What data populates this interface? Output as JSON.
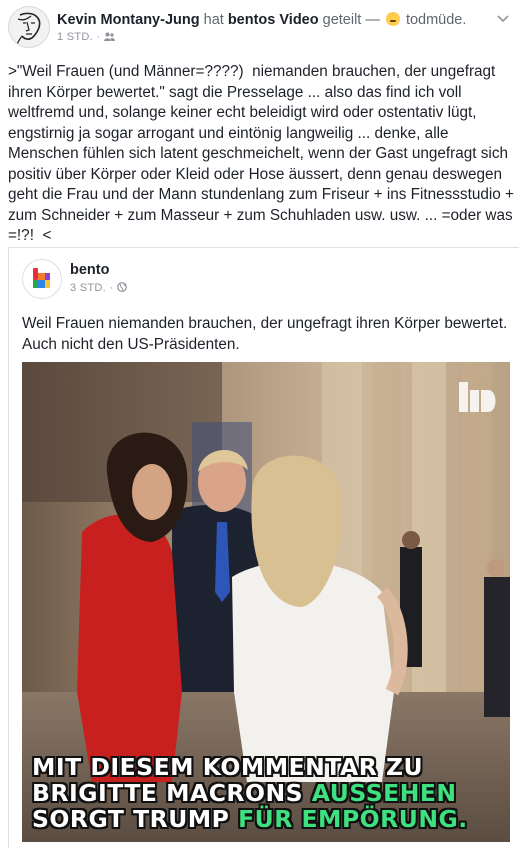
{
  "post": {
    "author": "Kevin Montany-Jung",
    "action_hat": "hat",
    "shared_source": "bentos",
    "shared_type": "Video",
    "action_geteilt": "geteilt —",
    "feeling": "todmüde.",
    "timestamp": "1 STD.",
    "text": ">\"Weil Frauen (und Männer=????)  niemanden brauchen, der ungefragt ihren Körper bewertet.\" sagt die Presselage ... also das find ich voll weltfremd und, solange keiner echt beleidigt wird oder ostentativ lügt, engstirnig ja sogar arrogant und eintönig langweilig ... denke, alle Menschen fühlen sich latent geschmeichelt, wenn der Gast ungefragt sich positiv über Körper oder Kleid oder Hose äussert, denn genau deswegen geht die Frau und der Mann stundenlang zum Friseur + ins Fitnessstudio + zum Schneider + zum Masseur + zum Schuhladen usw. usw. ... =oder was =!?!  <"
  },
  "shared": {
    "page_name": "bento",
    "timestamp": "3 STD.",
    "caption": "Weil Frauen niemanden brauchen, der ungefragt ihren Körper bewertet. Auch nicht den US-Präsidenten.",
    "video_overlay": {
      "line1": "MIT DIESEM KOMMENTAR ZU",
      "line2_a": "BRIGITTE MACRONS",
      "line2_b": "AUSSEHEN",
      "line3_a": "SORGT TRUMP",
      "line3_b": "FÜR EMPÖRUNG."
    },
    "accent_color": "#3ee07f"
  },
  "icons": {
    "privacy": "friends-icon",
    "globe": "globe-icon",
    "caret": "chevron-down-icon",
    "feeling": "sleepy-emoji-icon"
  }
}
